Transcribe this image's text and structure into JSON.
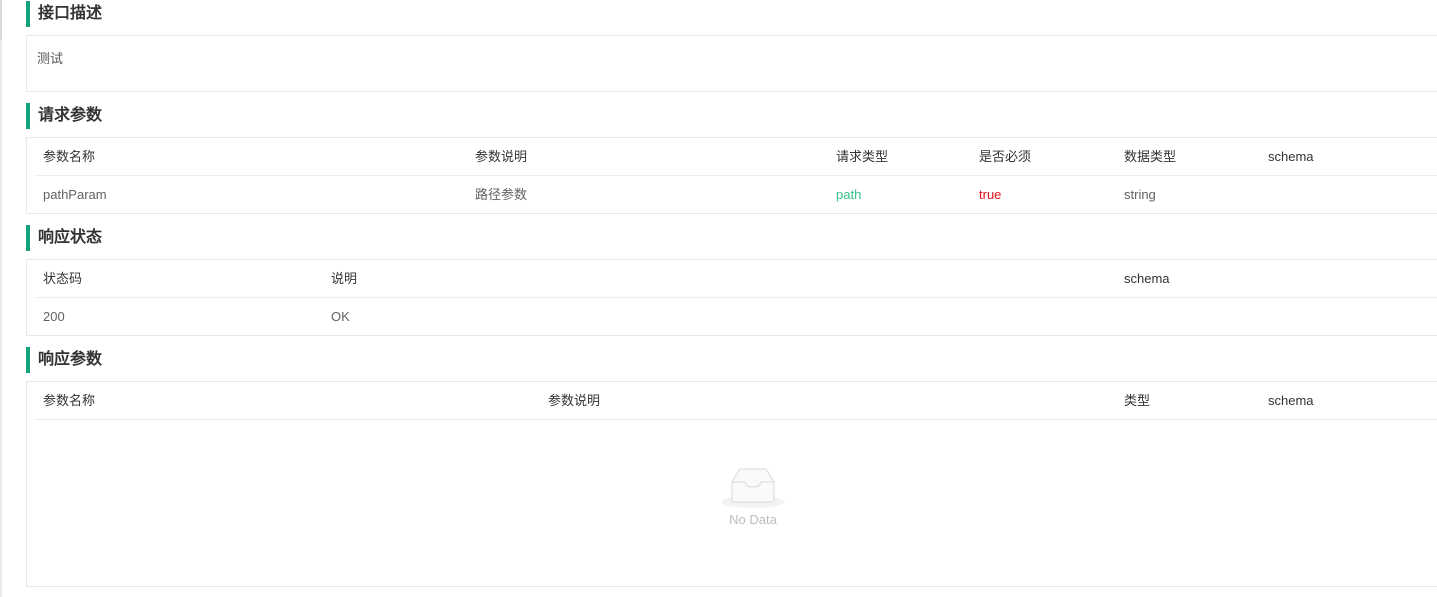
{
  "sections": {
    "description": {
      "title": "接口描述",
      "text": "测试"
    },
    "request_params": {
      "title": "请求参数",
      "columns": [
        "参数名称",
        "参数说明",
        "请求类型",
        "是否必须",
        "数据类型",
        "schema"
      ],
      "rows": [
        [
          "pathParam",
          "路径参数",
          "path",
          "true",
          "string",
          ""
        ]
      ]
    },
    "response_status": {
      "title": "响应状态",
      "columns": [
        "状态码",
        "说明",
        "schema"
      ],
      "rows": [
        [
          "200",
          "OK",
          ""
        ]
      ]
    },
    "response_params": {
      "title": "响应参数",
      "columns": [
        "参数名称",
        "参数说明",
        "类型",
        "schema"
      ],
      "rows": [],
      "empty_text": "No Data"
    }
  },
  "colors": {
    "accent": "#12a37a",
    "path_type": "#36c08a",
    "required_true": "#e4111a",
    "border": "#e8e8e8"
  },
  "icons": {
    "empty_state": "empty-inbox-icon"
  }
}
